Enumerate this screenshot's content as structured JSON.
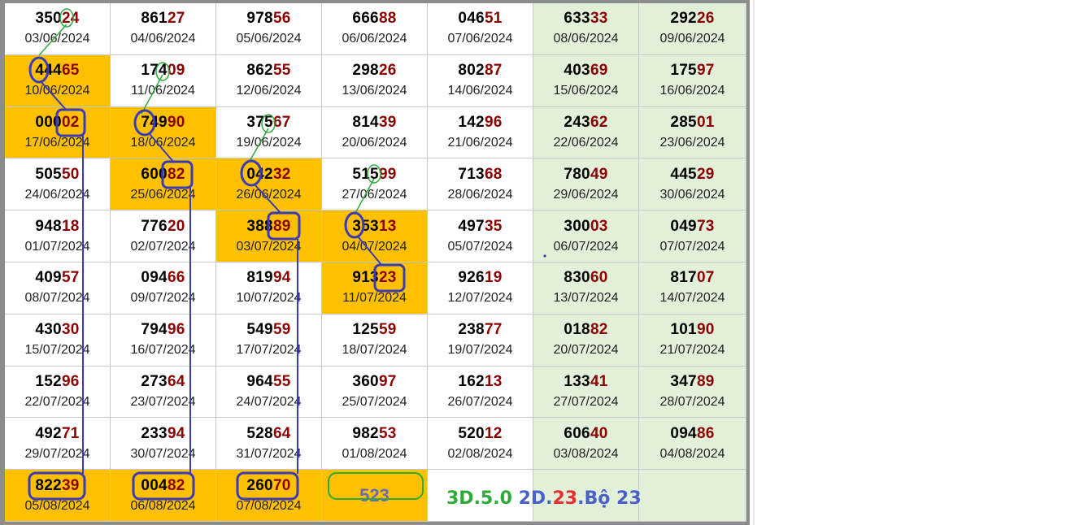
{
  "columns": 7,
  "colors": {
    "highlight": "#ffc000",
    "weekend": "#e2f0d9",
    "tail_digits": "#8b0000",
    "blue_mark": "#3b3bb8",
    "green_mark": "#2eaa3a"
  },
  "rows": [
    [
      {
        "head": "350",
        "tail": "24",
        "date": "03/06/2024"
      },
      {
        "head": "861",
        "tail": "27",
        "date": "04/06/2024"
      },
      {
        "head": "978",
        "tail": "56",
        "date": "05/06/2024"
      },
      {
        "head": "666",
        "tail": "88",
        "date": "06/06/2024"
      },
      {
        "head": "046",
        "tail": "51",
        "date": "07/06/2024"
      },
      {
        "head": "633",
        "tail": "33",
        "date": "08/06/2024"
      },
      {
        "head": "292",
        "tail": "26",
        "date": "09/06/2024"
      }
    ],
    [
      {
        "head": "444",
        "tail": "65",
        "date": "10/06/2024",
        "hl": true
      },
      {
        "head": "174",
        "tail": "09",
        "date": "11/06/2024"
      },
      {
        "head": "862",
        "tail": "55",
        "date": "12/06/2024"
      },
      {
        "head": "298",
        "tail": "26",
        "date": "13/06/2024"
      },
      {
        "head": "802",
        "tail": "87",
        "date": "14/06/2024"
      },
      {
        "head": "403",
        "tail": "69",
        "date": "15/06/2024"
      },
      {
        "head": "175",
        "tail": "97",
        "date": "16/06/2024"
      }
    ],
    [
      {
        "head": "000",
        "tail": "02",
        "date": "17/06/2024",
        "hl": true
      },
      {
        "head": "749",
        "tail": "90",
        "date": "18/06/2024",
        "hl": true
      },
      {
        "head": "375",
        "tail": "67",
        "date": "19/06/2024"
      },
      {
        "head": "814",
        "tail": "39",
        "date": "20/06/2024"
      },
      {
        "head": "142",
        "tail": "96",
        "date": "21/06/2024"
      },
      {
        "head": "243",
        "tail": "62",
        "date": "22/06/2024"
      },
      {
        "head": "285",
        "tail": "01",
        "date": "23/06/2024"
      }
    ],
    [
      {
        "head": "505",
        "tail": "50",
        "date": "24/06/2024"
      },
      {
        "head": "600",
        "tail": "82",
        "date": "25/06/2024",
        "hl": true
      },
      {
        "head": "042",
        "tail": "32",
        "date": "26/06/2024",
        "hl": true
      },
      {
        "head": "515",
        "tail": "99",
        "date": "27/06/2024"
      },
      {
        "head": "713",
        "tail": "68",
        "date": "28/06/2024"
      },
      {
        "head": "780",
        "tail": "49",
        "date": "29/06/2024"
      },
      {
        "head": "445",
        "tail": "29",
        "date": "30/06/2024"
      }
    ],
    [
      {
        "head": "948",
        "tail": "18",
        "date": "01/07/2024"
      },
      {
        "head": "776",
        "tail": "20",
        "date": "02/07/2024"
      },
      {
        "head": "388",
        "tail": "89",
        "date": "03/07/2024",
        "hl": true
      },
      {
        "head": "353",
        "tail": "13",
        "date": "04/07/2024",
        "hl": true
      },
      {
        "head": "497",
        "tail": "35",
        "date": "05/07/2024"
      },
      {
        "head": "300",
        "tail": "03",
        "date": "06/07/2024"
      },
      {
        "head": "049",
        "tail": "73",
        "date": "07/07/2024"
      }
    ],
    [
      {
        "head": "409",
        "tail": "57",
        "date": "08/07/2024"
      },
      {
        "head": "094",
        "tail": "66",
        "date": "09/07/2024"
      },
      {
        "head": "819",
        "tail": "94",
        "date": "10/07/2024"
      },
      {
        "head": "913",
        "tail": "23",
        "date": "11/07/2024",
        "hl": true
      },
      {
        "head": "926",
        "tail": "19",
        "date": "12/07/2024"
      },
      {
        "head": "830",
        "tail": "60",
        "date": "13/07/2024"
      },
      {
        "head": "817",
        "tail": "07",
        "date": "14/07/2024"
      }
    ],
    [
      {
        "head": "430",
        "tail": "30",
        "date": "15/07/2024"
      },
      {
        "head": "794",
        "tail": "96",
        "date": "16/07/2024"
      },
      {
        "head": "549",
        "tail": "59",
        "date": "17/07/2024"
      },
      {
        "head": "125",
        "tail": "59",
        "date": "18/07/2024"
      },
      {
        "head": "238",
        "tail": "77",
        "date": "19/07/2024"
      },
      {
        "head": "018",
        "tail": "82",
        "date": "20/07/2024"
      },
      {
        "head": "101",
        "tail": "90",
        "date": "21/07/2024"
      }
    ],
    [
      {
        "head": "152",
        "tail": "96",
        "date": "22/07/2024"
      },
      {
        "head": "273",
        "tail": "64",
        "date": "23/07/2024"
      },
      {
        "head": "964",
        "tail": "55",
        "date": "24/07/2024"
      },
      {
        "head": "360",
        "tail": "97",
        "date": "25/07/2024"
      },
      {
        "head": "162",
        "tail": "13",
        "date": "26/07/2024"
      },
      {
        "head": "133",
        "tail": "41",
        "date": "27/07/2024"
      },
      {
        "head": "347",
        "tail": "89",
        "date": "28/07/2024"
      }
    ],
    [
      {
        "head": "492",
        "tail": "71",
        "date": "29/07/2024"
      },
      {
        "head": "233",
        "tail": "94",
        "date": "30/07/2024"
      },
      {
        "head": "528",
        "tail": "64",
        "date": "31/07/2024"
      },
      {
        "head": "982",
        "tail": "53",
        "date": "01/08/2024"
      },
      {
        "head": "520",
        "tail": "12",
        "date": "02/08/2024"
      },
      {
        "head": "606",
        "tail": "40",
        "date": "03/08/2024"
      },
      {
        "head": "094",
        "tail": "86",
        "date": "04/08/2024"
      }
    ],
    [
      {
        "head": "822",
        "tail": "39",
        "date": "05/08/2024",
        "hl": true
      },
      {
        "head": "004",
        "tail": "82",
        "date": "06/08/2024",
        "hl": true
      },
      {
        "head": "260",
        "tail": "70",
        "date": "07/08/2024",
        "hl": true
      },
      {
        "note": "523",
        "hl": true
      },
      {
        "blank": true
      },
      {
        "blank": true
      },
      {
        "blank": true
      }
    ]
  ],
  "summary": [
    {
      "text": "3D.5.0 ",
      "color": "#2eaa3a"
    },
    {
      "text": "2D.",
      "color": "#4a5fc8"
    },
    {
      "text": "23",
      "color": "#e03030"
    },
    {
      "text": ".Bộ 23",
      "color": "#4a5fc8"
    }
  ]
}
